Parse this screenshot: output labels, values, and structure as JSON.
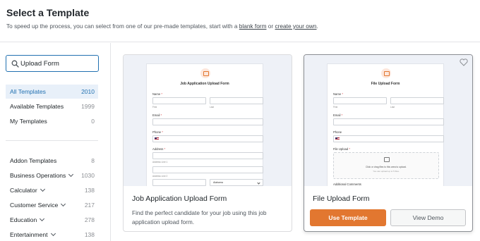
{
  "header": {
    "title": "Select a Template",
    "subtitle_prefix": "To speed up the process, you can select from one of our pre-made templates, start with a",
    "blank_form_link": "blank form",
    "subtitle_or": "or",
    "create_own_link": "create your own",
    "subtitle_end": "."
  },
  "search": {
    "value": "Upload Form"
  },
  "sidebar": {
    "primary": [
      {
        "label": "All Templates",
        "count": "2010",
        "active": true
      },
      {
        "label": "Available Templates",
        "count": "1999"
      },
      {
        "label": "My Templates",
        "count": "0"
      }
    ],
    "categories": [
      {
        "label": "Addon Templates",
        "count": "8"
      },
      {
        "label": "Business Operations",
        "count": "1030"
      },
      {
        "label": "Calculator",
        "count": "138"
      },
      {
        "label": "Customer Service",
        "count": "217"
      },
      {
        "label": "Education",
        "count": "278"
      },
      {
        "label": "Entertainment",
        "count": "138"
      }
    ]
  },
  "cards": [
    {
      "name": "Job Application Upload Form",
      "description": "Find the perfect candidate for your job using this job application upload form.",
      "preview": {
        "form_title": "Job Application Upload Form",
        "name_label": "Name",
        "first": "First",
        "last": "Last",
        "email_label": "Email",
        "phone_label": "Phone",
        "address_label": "Address",
        "address_line_1": "Address Line 1",
        "address_line_2": "Address Line 2",
        "state_value": "Alabama"
      }
    },
    {
      "name": "File Upload Form",
      "use_label": "Use Template",
      "demo_label": "View Demo",
      "preview": {
        "form_title": "File Upload Form",
        "name_label": "Name",
        "first": "First",
        "last": "Last",
        "email_label": "Email",
        "phone_label": "Phone",
        "upload_label": "File Upload",
        "upload_text": "Click or drag files to this area to upload.",
        "upload_hint": "You can upload up to 5 files.",
        "comments_label": "Additional Comments"
      }
    }
  ],
  "colors": {
    "accent": "#e27730",
    "link": "#2271b1",
    "active_bg": "#e8f0f9"
  }
}
